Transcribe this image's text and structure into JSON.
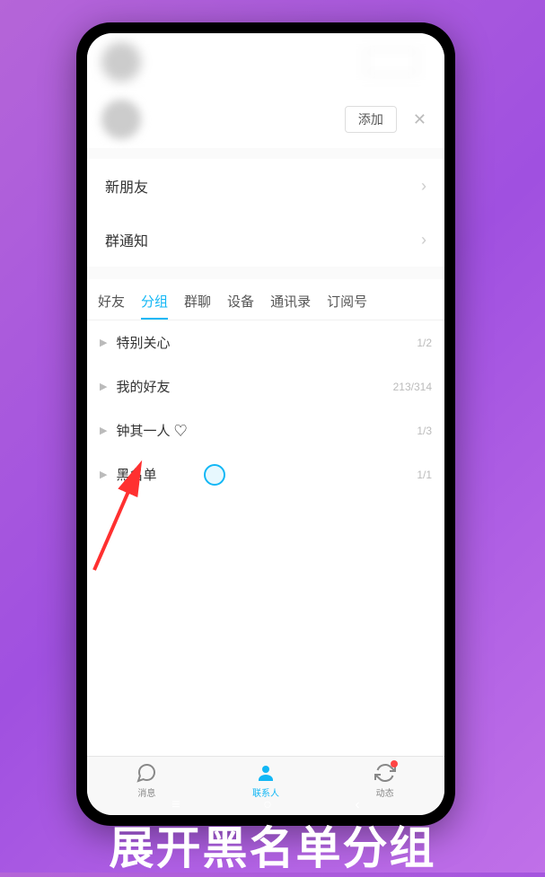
{
  "contact_suggestion": {
    "add_button": "添加"
  },
  "menu": {
    "new_friends": "新朋友",
    "group_notifications": "群通知"
  },
  "tabs": [
    {
      "label": "好友",
      "active": false
    },
    {
      "label": "分组",
      "active": true
    },
    {
      "label": "群聊",
      "active": false
    },
    {
      "label": "设备",
      "active": false
    },
    {
      "label": "通讯录",
      "active": false
    },
    {
      "label": "订阅号",
      "active": false
    }
  ],
  "groups": [
    {
      "name": "特别关心",
      "count": "1/2"
    },
    {
      "name": "我的好友",
      "count": "213/314"
    },
    {
      "name": "钟其一人 ♡",
      "count": "1/3"
    },
    {
      "name": "黑名单",
      "count": "1/1"
    }
  ],
  "bottom_nav": [
    {
      "label": "消息",
      "active": false
    },
    {
      "label": "联系人",
      "active": true
    },
    {
      "label": "动态",
      "active": false,
      "badge": true
    }
  ],
  "caption": "展开黑名单分组"
}
